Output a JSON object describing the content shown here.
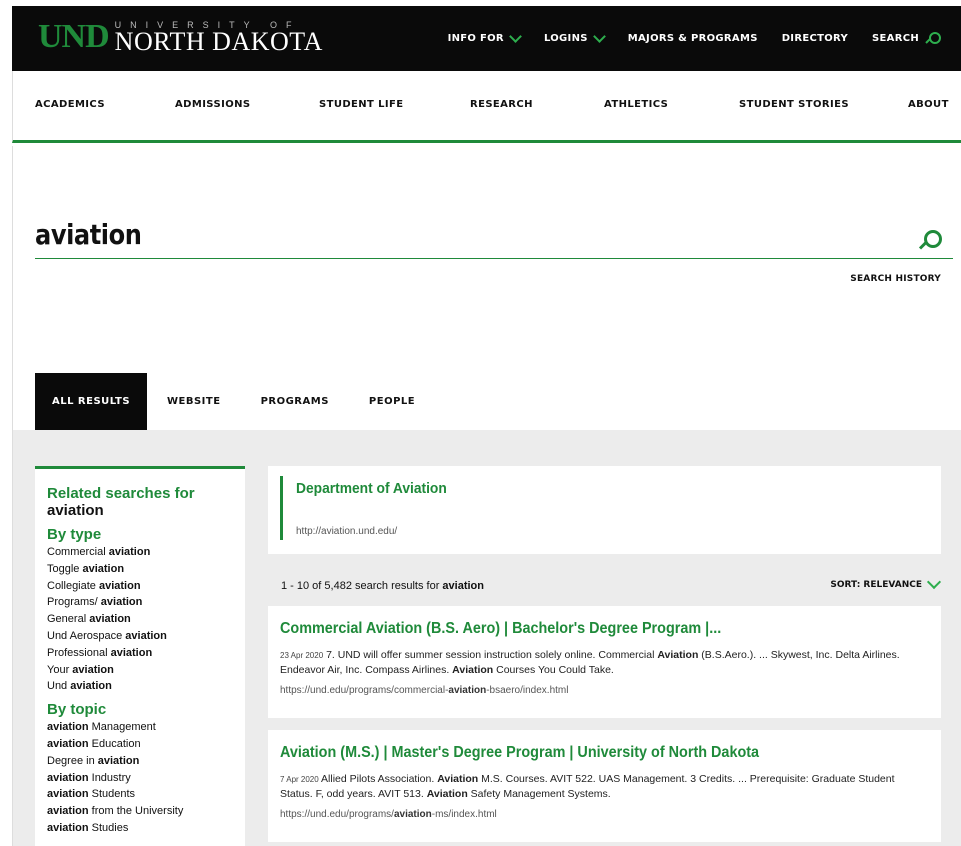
{
  "header": {
    "logo": {
      "und": "UND",
      "university_of": "UNIVERSITY OF",
      "north_dakota": "NORTH DAKOTA"
    },
    "top_links": [
      {
        "label": "INFO FOR",
        "icon": "chevron-down-icon"
      },
      {
        "label": "LOGINS",
        "icon": "chevron-down-icon"
      },
      {
        "label": "MAJORS & PROGRAMS"
      },
      {
        "label": "DIRECTORY"
      },
      {
        "label": "SEARCH",
        "icon": "search-icon"
      }
    ]
  },
  "main_nav": [
    "ACADEMICS",
    "ADMISSIONS",
    "STUDENT LIFE",
    "RESEARCH",
    "ATHLETICS",
    "STUDENT STORIES",
    "ABOUT"
  ],
  "search": {
    "query": "aviation",
    "history_label": "SEARCH HISTORY"
  },
  "tabs": [
    {
      "label": "ALL RESULTS",
      "active": true
    },
    {
      "label": "WEBSITE"
    },
    {
      "label": "PROGRAMS"
    },
    {
      "label": "PEOPLE"
    }
  ],
  "sidebar": {
    "heading": "Related searches for",
    "query": "aviation",
    "by_type_label": "By type",
    "by_type": [
      [
        "Commercial ",
        "aviation",
        ""
      ],
      [
        "Toggle ",
        "aviation",
        ""
      ],
      [
        "Collegiate ",
        "aviation",
        ""
      ],
      [
        "Programs/ ",
        "aviation",
        ""
      ],
      [
        "General ",
        "aviation",
        ""
      ],
      [
        "Und Aerospace ",
        "aviation",
        ""
      ],
      [
        "Professional ",
        "aviation",
        ""
      ],
      [
        "Your ",
        "aviation",
        ""
      ],
      [
        "Und ",
        "aviation",
        ""
      ]
    ],
    "by_topic_label": "By topic",
    "by_topic": [
      [
        "",
        "aviation",
        " Management"
      ],
      [
        "",
        "aviation",
        " Education"
      ],
      [
        "Degree in ",
        "aviation",
        ""
      ],
      [
        "",
        "aviation",
        " Industry"
      ],
      [
        "",
        "aviation",
        " Students"
      ],
      [
        "",
        "aviation",
        " from the University"
      ],
      [
        "",
        "aviation",
        " Studies"
      ]
    ]
  },
  "featured": {
    "title": "Department of Aviation",
    "url": "http://aviation.und.edu/"
  },
  "results_summary": {
    "range": "1 - 10 of 5,482 search results for ",
    "query": "aviation",
    "sort_label": "SORT: RELEVANCE"
  },
  "results": [
    {
      "title": "Commercial Aviation (B.S. Aero) | Bachelor's Degree Program |...",
      "date": "23 Apr 2020",
      "snippet": [
        [
          "",
          " 7. UND will offer summer session instruction solely online. Commercial "
        ],
        [
          "Aviation",
          " (B.S.Aero.). ... Skywest, Inc. Delta Airlines. Endeavor Air, Inc. Compass Airlines. "
        ],
        [
          "Aviation",
          " Courses You Could Take."
        ]
      ],
      "url": [
        "https://und.edu/programs/commercial-",
        "aviation",
        "-bsaero/index.html"
      ]
    },
    {
      "title": "Aviation (M.S.) | Master's Degree Program | University of North Dakota",
      "date": "7 Apr 2020",
      "snippet": [
        [
          "",
          " Allied Pilots Association. "
        ],
        [
          "Aviation",
          " M.S. Courses. AVIT 522. UAS Management. 3 Credits. ... Prerequisite: Graduate Student Status. F, odd years. AVIT 513. "
        ],
        [
          "Aviation",
          " Safety Management Systems."
        ]
      ],
      "url": [
        "https://und.edu/programs/",
        "aviation",
        "-ms/index.html"
      ]
    }
  ],
  "colors": {
    "brand_green": "#1f8a3a",
    "bright_green": "#2eae4e",
    "black": "#0a0a0a",
    "grey_bg": "#ececec"
  }
}
